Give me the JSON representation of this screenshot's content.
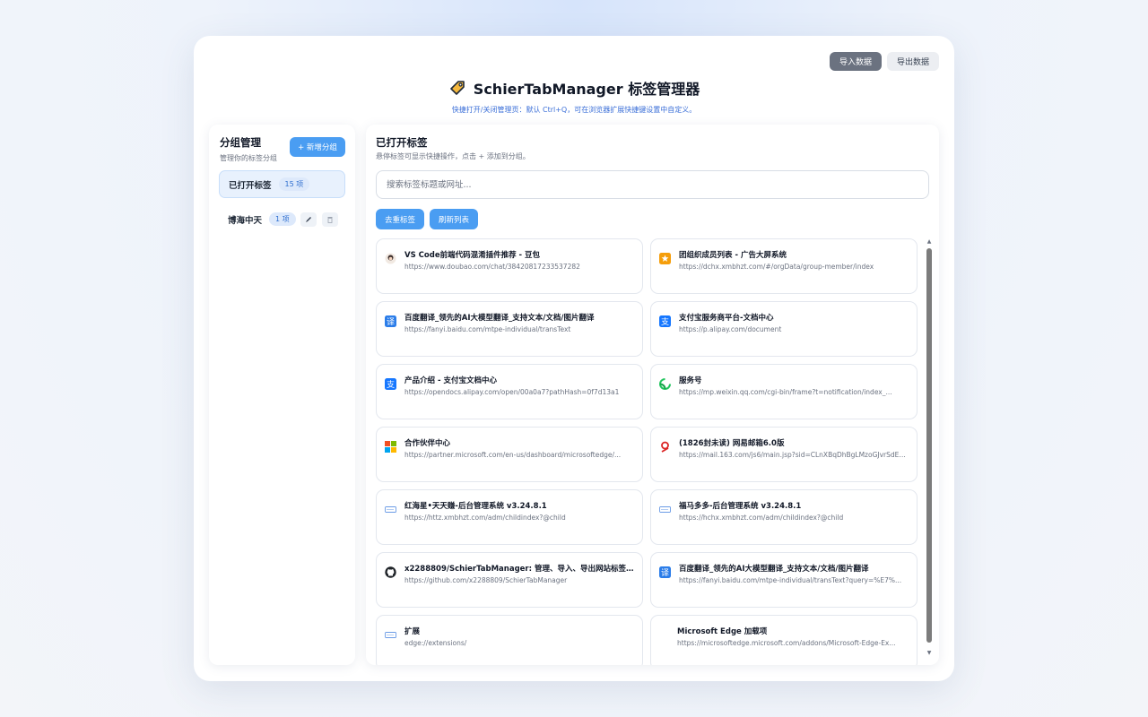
{
  "top_actions": {
    "import_label": "导入数据",
    "export_label": "导出数据"
  },
  "header": {
    "title": "SchierTabManager 标签管理器",
    "subtitle": "快捷打开/关闭管理页：默认 Ctrl+Q，可在浏览器扩展快捷键设置中自定义。"
  },
  "sidebar": {
    "title": "分组管理",
    "description": "管理你的标签分组",
    "new_group_label": "+ 新增分组",
    "groups": [
      {
        "name": "已打开标签",
        "count": "15 项",
        "active": true
      },
      {
        "name": "博海中天",
        "count": "1 项",
        "edit_icon": "pencil-icon",
        "delete_icon": "trash-icon"
      }
    ]
  },
  "main": {
    "title": "已打开标签",
    "description": "悬停标签可显示快捷操作，点击 + 添加到分组。",
    "search_placeholder": "搜索标签标题或网址...",
    "dedup_label": "去重标签",
    "refresh_label": "刷新列表",
    "tabs": [
      {
        "title": "VS Code前端代码混淆插件推荐 - 豆包",
        "url": "https://www.doubao.com/chat/38420817233537282",
        "icon": "doubao-icon"
      },
      {
        "title": "团组织成员列表 - 广告大屏系统",
        "url": "https://dchx.xmbhzt.com/#/orgData/group-member/index",
        "icon": "orange-star-icon"
      },
      {
        "title": "百度翻译_领先的AI大模型翻译_支持文本/文档/图片翻译",
        "url": "https://fanyi.baidu.com/mtpe-individual/transText",
        "icon": "baidu-translate-icon"
      },
      {
        "title": "支付宝服务商平台-文档中心",
        "url": "https://p.alipay.com/document",
        "icon": "alipay-icon"
      },
      {
        "title": "产品介绍 - 支付宝文档中心",
        "url": "https://opendocs.alipay.com/open/00a0a7?pathHash=0f7d13a1",
        "icon": "alipay-icon"
      },
      {
        "title": "服务号",
        "url": "https://mp.weixin.qq.com/cgi-bin/frame?t=notification/index_...",
        "icon": "wechat-mp-icon"
      },
      {
        "title": "合作伙伴中心",
        "url": "https://partner.microsoft.com/en-us/dashboard/microsoftedge/...",
        "icon": "microsoft-icon"
      },
      {
        "title": "(1826封未读) 网易邮箱6.0版",
        "url": "https://mail.163.com/js6/main.jsp?sid=CLnXBqDhBgLMzoGJvrSdEG...",
        "icon": "netease-mail-icon"
      },
      {
        "title": "红海星•天天赚-后台管理系统 v3.24.8.1",
        "url": "https://httz.xmbhzt.com/adm/childindex?@child",
        "icon": "default-web-icon"
      },
      {
        "title": "福马多多-后台管理系统 v3.24.8.1",
        "url": "https://hchx.xmbhzt.com/adm/childindex?@child",
        "icon": "default-web-icon"
      },
      {
        "title": "x2288809/SchierTabManager: 管理、导入、导出网站标签的...",
        "url": "https://github.com/x2288809/SchierTabManager",
        "icon": "github-icon"
      },
      {
        "title": "百度翻译_领先的AI大模型翻译_支持文本/文档/图片翻译",
        "url": "https://fanyi.baidu.com/mtpe-individual/transText?query=%E7%...",
        "icon": "baidu-translate-icon"
      },
      {
        "title": "扩展",
        "url": "edge://extensions/",
        "icon": "default-web-icon"
      },
      {
        "title": "Microsoft Edge 加载项",
        "url": "https://microsoftedge.microsoft.com/addons/Microsoft-Edge-Ex...",
        "icon": "edge-addons-icon"
      }
    ]
  },
  "colors": {
    "accent": "#4a9df2",
    "import_button": "#6b7280",
    "subtitle": "#3b6fd8"
  }
}
